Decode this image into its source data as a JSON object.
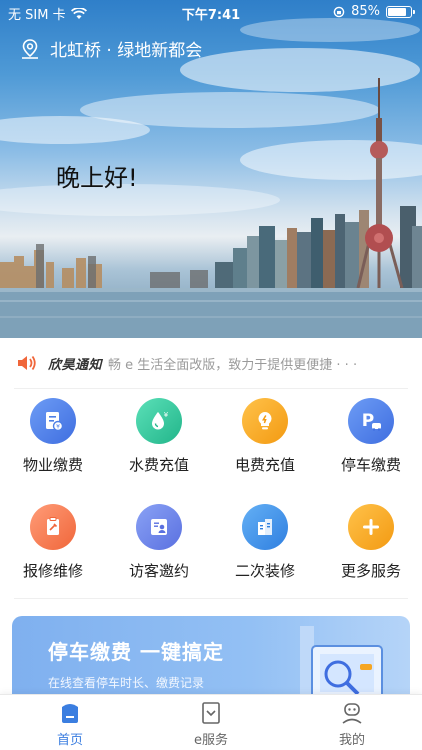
{
  "status_bar": {
    "carrier": "无 SIM 卡",
    "time": "下午7:41",
    "battery": "85%",
    "battery_level": 0.85
  },
  "location": {
    "name": "北虹桥 · 绿地新都会"
  },
  "greeting": "晚上好!",
  "notice": {
    "tag": "欣昊通知",
    "text": "畅 e 生活全面改版，致力于提供更便捷 · · ·"
  },
  "services": [
    {
      "label": "物业缴费",
      "icon": "property-bill-icon",
      "color": "#4d7fe6"
    },
    {
      "label": "水费充值",
      "icon": "water-drop-icon",
      "color": "#2fc69a"
    },
    {
      "label": "电费充值",
      "icon": "lightbulb-icon",
      "color": "#f5a623"
    },
    {
      "label": "停车缴费",
      "icon": "parking-icon",
      "color": "#4d7fe6"
    },
    {
      "label": "报修维修",
      "icon": "repair-clipboard-icon",
      "color": "#f57b55"
    },
    {
      "label": "访客邀约",
      "icon": "visitor-card-icon",
      "color": "#6a82e8"
    },
    {
      "label": "二次装修",
      "icon": "building-icon",
      "color": "#3e8ee6"
    },
    {
      "label": "更多服务",
      "icon": "plus-icon",
      "color": "#f5a623"
    }
  ],
  "banner": {
    "title": "停车缴费 一键搞定",
    "subtitle": "在线查看停车时长、缴费记录"
  },
  "tabs": [
    {
      "label": "首页",
      "icon": "home-icon",
      "active": true
    },
    {
      "label": "e服务",
      "icon": "service-icon",
      "active": false
    },
    {
      "label": "我的",
      "icon": "profile-icon",
      "active": false
    }
  ],
  "colors": {
    "accent": "#3b7ee0",
    "notice_speaker": "#f0663a"
  }
}
